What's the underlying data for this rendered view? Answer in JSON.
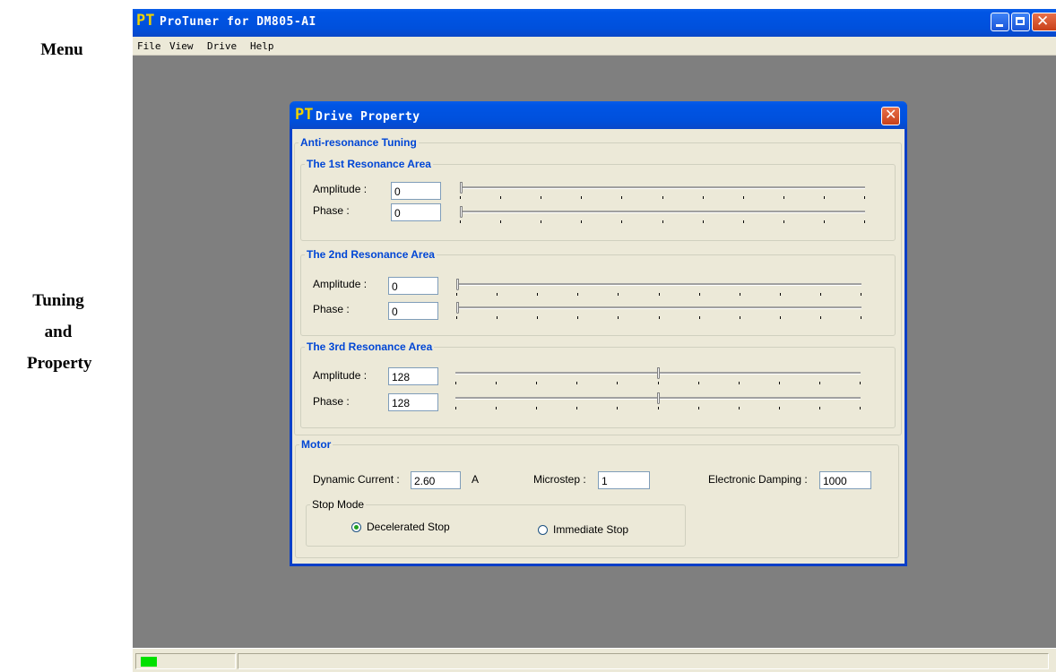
{
  "annotations": {
    "menu": "Menu",
    "tuning": [
      "Tuning",
      "and",
      "Property"
    ]
  },
  "app": {
    "logo": "PT",
    "title": "ProTuner for DM805-AI",
    "menu": [
      "File",
      "View",
      "Drive",
      "Help"
    ],
    "icons": {
      "minimize": "minimize-icon",
      "maximize": "maximize-icon",
      "close": "close-icon"
    },
    "status": {
      "led_color": "#00e000"
    }
  },
  "dialog": {
    "logo": "PT",
    "title": "Drive Property",
    "anti_resonance": {
      "title": "Anti-resonance Tuning",
      "areas": [
        {
          "title": "The 1st Resonance Area",
          "amplitude_label": "Amplitude :",
          "amplitude": "0",
          "phase_label": "Phase :",
          "phase": "0",
          "amplitude_slider_fraction": 0,
          "phase_slider_fraction": 0
        },
        {
          "title": "The 2nd Resonance Area",
          "amplitude_label": "Amplitude :",
          "amplitude": "0",
          "phase_label": "Phase :",
          "phase": "0",
          "amplitude_slider_fraction": 0,
          "phase_slider_fraction": 0
        },
        {
          "title": "The 3rd Resonance Area",
          "amplitude_label": "Amplitude :",
          "amplitude": "128",
          "phase_label": "Phase :",
          "phase": "128",
          "amplitude_slider_fraction": 0.5,
          "phase_slider_fraction": 0.5
        }
      ]
    },
    "motor": {
      "title": "Motor",
      "dynamic_current_label": "Dynamic Current :",
      "dynamic_current": "2.60",
      "dynamic_current_unit": "A",
      "microstep_label": "Microstep :",
      "microstep": "1",
      "damping_label": "Electronic Damping :",
      "damping": "1000",
      "stop_mode": {
        "title": "Stop Mode",
        "options": [
          "Decelerated Stop",
          "Immediate Stop"
        ],
        "selected": "Decelerated Stop"
      }
    }
  },
  "colors": {
    "titlebar": "#0055e5",
    "group_title": "#0046d5",
    "workspace": "#7f7f7f",
    "dialog_bg": "#ece9d8"
  }
}
